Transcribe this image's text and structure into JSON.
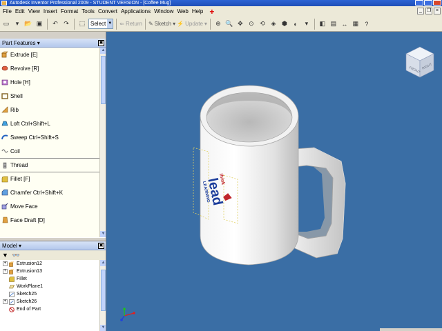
{
  "window": {
    "title": "Autodesk Inventor Professional 2009 - STUDENT VERSION - [Coffee Mug]"
  },
  "menu": {
    "items": [
      "File",
      "Edit",
      "View",
      "Insert",
      "Format",
      "Tools",
      "Convert",
      "Applications",
      "Window",
      "Web",
      "Help"
    ]
  },
  "toolbar": {
    "select_label": "Select",
    "return_label": "Return",
    "sketch_label": "Sketch",
    "update_label": "Update"
  },
  "part_features": {
    "header": "Part Features ▾",
    "items": [
      {
        "label": "Extrude   [E]",
        "icon": "extrude-icon"
      },
      {
        "label": "Revolve   [R]",
        "icon": "revolve-icon"
      },
      {
        "label": "Hole   [H]",
        "icon": "hole-icon"
      },
      {
        "label": "Shell",
        "icon": "shell-icon"
      },
      {
        "label": "Rib",
        "icon": "rib-icon"
      },
      {
        "label": "Loft   Ctrl+Shift+L",
        "icon": "loft-icon"
      },
      {
        "label": "Sweep   Ctrl+Shift+S",
        "icon": "sweep-icon"
      },
      {
        "label": "Coil",
        "icon": "coil-icon"
      },
      {
        "label": "Thread",
        "icon": "thread-icon"
      },
      {
        "label": "Fillet   [F]",
        "icon": "fillet-icon"
      },
      {
        "label": "Chamfer   Ctrl+Shift+K",
        "icon": "chamfer-icon"
      },
      {
        "label": "Move Face",
        "icon": "move-face-icon"
      },
      {
        "label": "Face Draft   [D]",
        "icon": "face-draft-icon"
      }
    ]
  },
  "model_browser": {
    "header": "Model ▾",
    "tree": [
      {
        "label": "Extrusion12",
        "expandable": true,
        "icon": "extrusion-icon"
      },
      {
        "label": "Extrusion13",
        "expandable": true,
        "icon": "extrusion-icon"
      },
      {
        "label": "Fillet",
        "expandable": false,
        "icon": "fillet-icon"
      },
      {
        "label": "WorkPlane1",
        "expandable": false,
        "icon": "workplane-icon"
      },
      {
        "label": "Sketch25",
        "expandable": false,
        "icon": "sketch-icon"
      },
      {
        "label": "Sketch26",
        "expandable": true,
        "icon": "sketch-icon"
      },
      {
        "label": "End of Part",
        "expandable": false,
        "icon": "end-of-part-icon"
      }
    ]
  },
  "viewcube": {
    "front_label": "FRONT",
    "right_label": "RIGHT"
  },
  "decal": {
    "top_text": "think",
    "main_text": "lead",
    "bottom_text": "LEARNING"
  },
  "colors": {
    "viewport_bg": "#3a6ea5",
    "mug": "#e6e6e6",
    "decal_blue": "#1d3e9c",
    "decal_red": "#c0262b"
  }
}
